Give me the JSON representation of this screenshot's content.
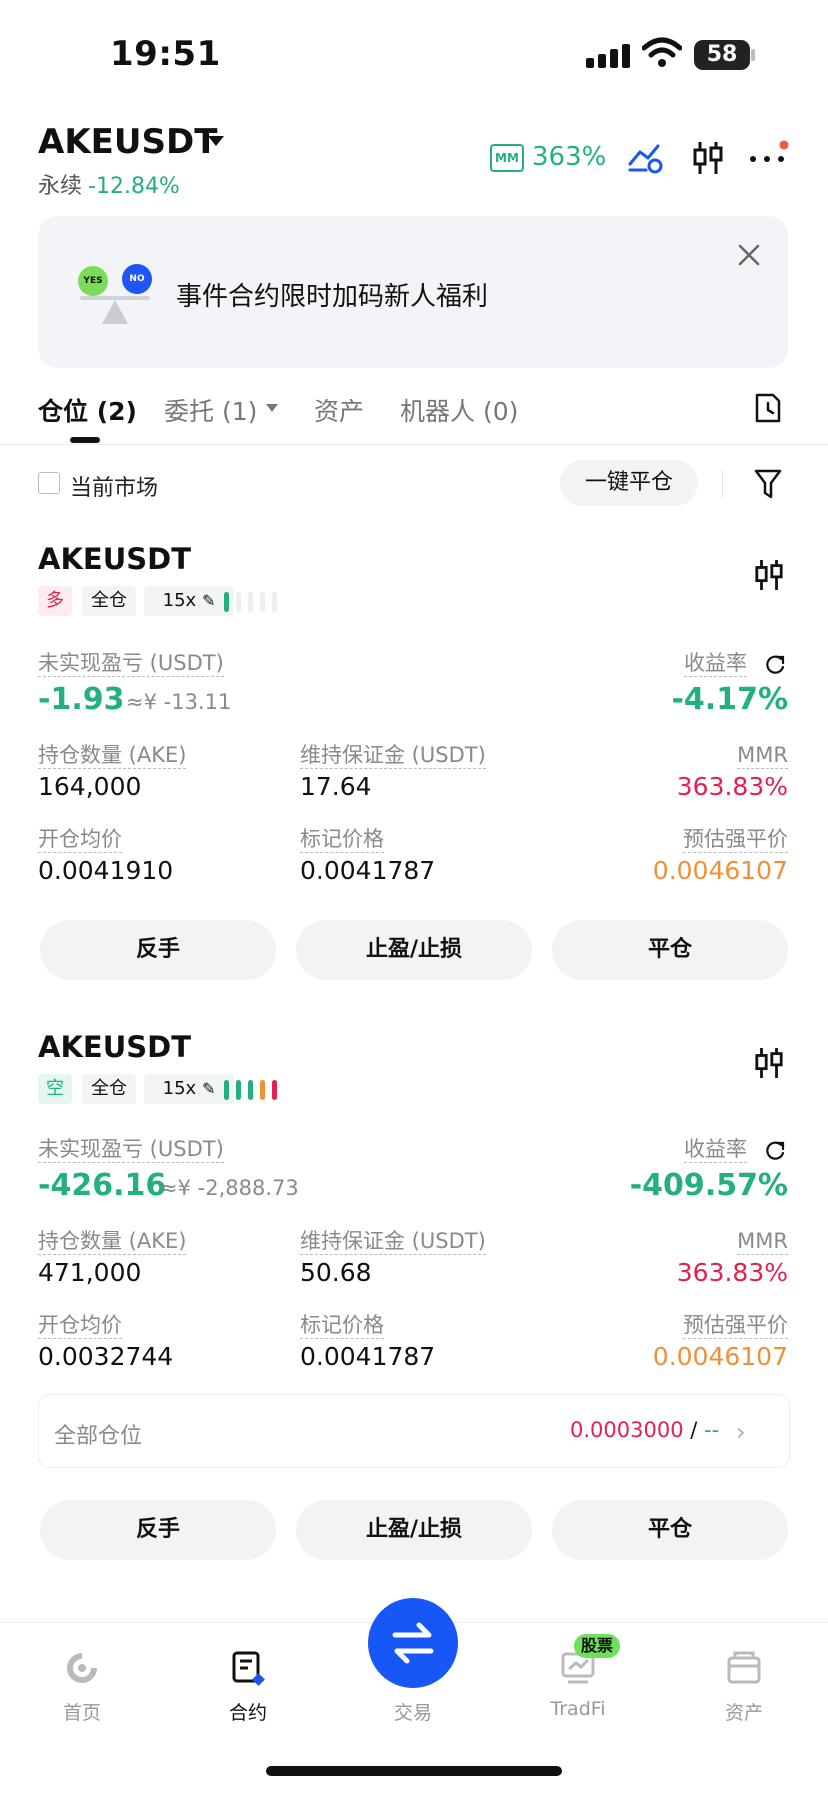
{
  "status_bar": {
    "time": "19:51",
    "battery": "58"
  },
  "header": {
    "pair": "AKEUSDT",
    "subtitle": "永续",
    "change": "-12.84%",
    "mm_badge": "MM",
    "mm_ratio": "363%"
  },
  "banner": {
    "text": "事件合约限时加码新人福利",
    "yes": "YES",
    "no": "NO"
  },
  "tabs": [
    {
      "label": "仓位 (2)"
    },
    {
      "label": "委托 (1)"
    },
    {
      "label": "资产"
    },
    {
      "label": "机器人 (0)"
    }
  ],
  "filter_bar": {
    "current_market": "当前市场",
    "close_all": "一键平仓"
  },
  "positions": [
    {
      "symbol": "AKEUSDT",
      "side": "多",
      "margin_mode": "全仓",
      "leverage": "15x",
      "risk_level": 1,
      "unrealized_pnl_label": "未实现盈亏 (USDT)",
      "unrealized_pnl": "-1.93",
      "unrealized_pnl_cny": "≈¥ -13.11",
      "roe_label": "收益率",
      "roe": "-4.17%",
      "size_label": "持仓数量 (AKE)",
      "size": "164,000",
      "maint_margin_label": "维持保证金 (USDT)",
      "maint_margin": "17.64",
      "mmr_label": "MMR",
      "mmr": "363.83%",
      "entry_label": "开仓均价",
      "entry": "0.0041910",
      "mark_label": "标记价格",
      "mark": "0.0041787",
      "liq_label": "预估强平价",
      "liq": "0.0046107"
    },
    {
      "symbol": "AKEUSDT",
      "side": "空",
      "margin_mode": "全仓",
      "leverage": "15x",
      "risk_level": 5,
      "unrealized_pnl_label": "未实现盈亏 (USDT)",
      "unrealized_pnl": "-426.16",
      "unrealized_pnl_cny": "≈¥ -2,888.73",
      "roe_label": "收益率",
      "roe": "-409.57%",
      "size_label": "持仓数量 (AKE)",
      "size": "471,000",
      "maint_margin_label": "维持保证金 (USDT)",
      "maint_margin": "50.68",
      "mmr_label": "MMR",
      "mmr": "363.83%",
      "entry_label": "开仓均价",
      "entry": "0.0032744",
      "mark_label": "标记价格",
      "mark": "0.0041787",
      "liq_label": "预估强平价",
      "liq": "0.0046107"
    }
  ],
  "all_positions": {
    "label": "全部仓位",
    "value": "0.0003000",
    "separator": "/",
    "secondary": "--"
  },
  "actions": {
    "reverse": "反手",
    "tp_sl": "止盈/止损",
    "close": "平仓"
  },
  "bottom_nav": [
    {
      "label": "首页"
    },
    {
      "label": "合约"
    },
    {
      "label": "交易"
    },
    {
      "label": "TradFi",
      "badge": "股票"
    },
    {
      "label": "资产"
    }
  ],
  "colors": {
    "up_green": "#22b07d",
    "down_red": "#e0234e",
    "warn_orange": "#f0913a",
    "brand_blue": "#1657f5"
  }
}
